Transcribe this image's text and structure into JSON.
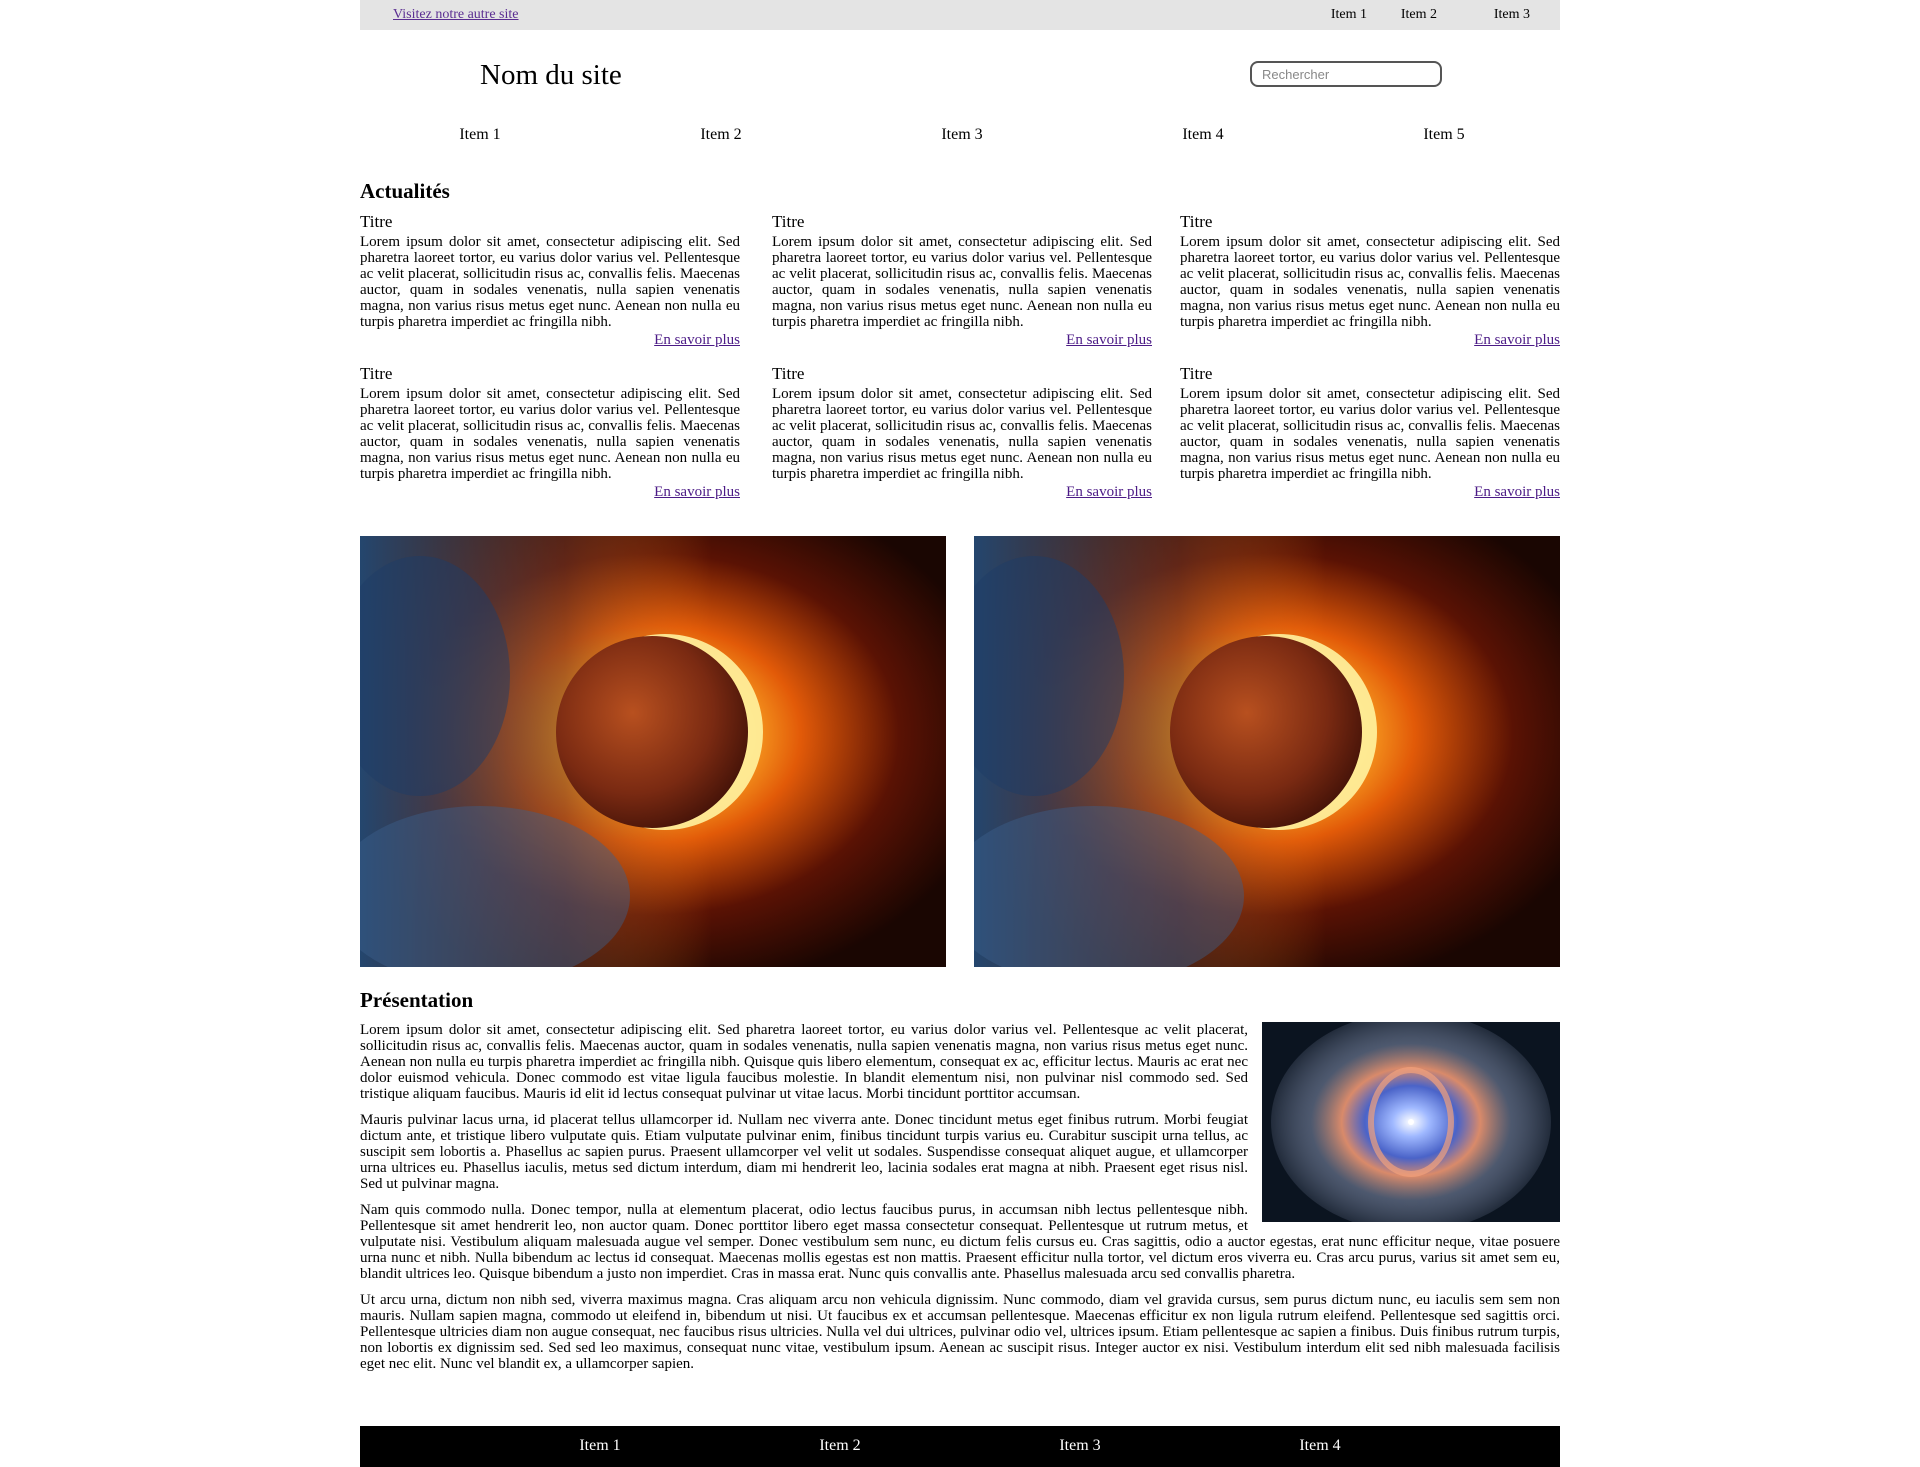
{
  "topbar": {
    "other_site_link": "Visitez notre autre site",
    "items": [
      "Item 1",
      "Item 2",
      "Item 3"
    ]
  },
  "header": {
    "site_name": "Nom du site",
    "search_placeholder": "Rechercher"
  },
  "main_nav": [
    "Item 1",
    "Item 2",
    "Item 3",
    "Item 4",
    "Item 5"
  ],
  "news": {
    "heading": "Actualités",
    "cards": [
      {
        "title": "Titre",
        "body": "Lorem ipsum dolor sit amet, consectetur adipiscing elit. Sed pharetra laoreet tortor, eu varius dolor varius vel. Pellentesque ac velit placerat, sollicitudin risus ac, convallis felis. Maecenas auctor, quam in sodales venenatis, nulla sapien venenatis magna, non varius risus metus eget nunc. Aenean non nulla eu turpis pharetra imperdiet ac fringilla nibh.",
        "more": "En savoir plus"
      },
      {
        "title": "Titre",
        "body": "Lorem ipsum dolor sit amet, consectetur adipiscing elit. Sed pharetra laoreet tortor, eu varius dolor varius vel. Pellentesque ac velit placerat, sollicitudin risus ac, convallis felis. Maecenas auctor, quam in sodales venenatis, nulla sapien venenatis magna, non varius risus metus eget nunc. Aenean non nulla eu turpis pharetra imperdiet ac fringilla nibh.",
        "more": "En savoir plus"
      },
      {
        "title": "Titre",
        "body": "Lorem ipsum dolor sit amet, consectetur adipiscing elit. Sed pharetra laoreet tortor, eu varius dolor varius vel. Pellentesque ac velit placerat, sollicitudin risus ac, convallis felis. Maecenas auctor, quam in sodales venenatis, nulla sapien venenatis magna, non varius risus metus eget nunc. Aenean non nulla eu turpis pharetra imperdiet ac fringilla nibh.",
        "more": "En savoir plus"
      },
      {
        "title": "Titre",
        "body": "Lorem ipsum dolor sit amet, consectetur adipiscing elit. Sed pharetra laoreet tortor, eu varius dolor varius vel. Pellentesque ac velit placerat, sollicitudin risus ac, convallis felis. Maecenas auctor, quam in sodales venenatis, nulla sapien venenatis magna, non varius risus metus eget nunc. Aenean non nulla eu turpis pharetra imperdiet ac fringilla nibh.",
        "more": "En savoir plus"
      },
      {
        "title": "Titre",
        "body": "Lorem ipsum dolor sit amet, consectetur adipiscing elit. Sed pharetra laoreet tortor, eu varius dolor varius vel. Pellentesque ac velit placerat, sollicitudin risus ac, convallis felis. Maecenas auctor, quam in sodales venenatis, nulla sapien venenatis magna, non varius risus metus eget nunc. Aenean non nulla eu turpis pharetra imperdiet ac fringilla nibh.",
        "more": "En savoir plus"
      },
      {
        "title": "Titre",
        "body": "Lorem ipsum dolor sit amet, consectetur adipiscing elit. Sed pharetra laoreet tortor, eu varius dolor varius vel. Pellentesque ac velit placerat, sollicitudin risus ac, convallis felis. Maecenas auctor, quam in sodales venenatis, nulla sapien venenatis magna, non varius risus metus eget nunc. Aenean non nulla eu turpis pharetra imperdiet ac fringilla nibh.",
        "more": "En savoir plus"
      }
    ]
  },
  "presentation": {
    "heading": "Présentation",
    "paragraphs": [
      "Lorem ipsum dolor sit amet, consectetur adipiscing elit. Sed pharetra laoreet tortor, eu varius dolor varius vel. Pellentesque ac velit placerat, sollicitudin risus ac, convallis felis. Maecenas auctor, quam in sodales venenatis, nulla sapien venenatis magna, non varius risus metus eget nunc. Aenean non nulla eu turpis pharetra imperdiet ac fringilla nibh. Quisque quis libero elementum, consequat ex ac, efficitur lectus. Mauris ac erat nec dolor euismod vehicula. Donec commodo est vitae ligula faucibus molestie. In blandit elementum nisi, non pulvinar nisl commodo sed. Sed tristique aliquam faucibus. Mauris id elit id lectus consequat pulvinar ut vitae lacus. Morbi tincidunt porttitor accumsan.",
      "Mauris pulvinar lacus urna, id placerat tellus ullamcorper id. Nullam nec viverra ante. Donec tincidunt metus eget finibus rutrum. Morbi feugiat dictum ante, et tristique libero vulputate quis. Etiam vulputate pulvinar enim, finibus tincidunt turpis varius eu. Curabitur suscipit urna tellus, ac suscipit sem lobortis a. Phasellus ac sapien purus. Praesent ullamcorper vel velit ut sodales. Suspendisse consequat aliquet augue, et ullamcorper urna ultrices eu. Phasellus iaculis, metus sed dictum interdum, diam mi hendrerit leo, lacinia sodales erat magna at nibh. Praesent eget risus nisl. Sed ut pulvinar magna.",
      "Nam quis commodo nulla. Donec tempor, nulla at elementum placerat, odio lectus faucibus purus, in accumsan nibh lectus pellentesque nibh. Pellentesque sit amet hendrerit leo, non auctor quam. Donec porttitor libero eget massa consectetur consequat. Pellentesque ut rutrum metus, et vulputate nisi. Vestibulum aliquam malesuada augue vel semper. Donec vestibulum sem nunc, eu dictum felis cursus eu. Cras sagittis, odio a auctor egestas, erat nunc efficitur neque, vitae posuere urna nunc et nibh. Nulla bibendum ac lectus id consequat. Maecenas mollis egestas est non mattis. Praesent efficitur nulla tortor, vel dictum eros viverra eu. Cras arcu purus, varius sit amet sem eu, blandit ultrices leo. Quisque bibendum a justo non imperdiet. Cras in massa erat. Nunc quis convallis ante. Phasellus malesuada arcu sed convallis pharetra.",
      "Ut arcu urna, dictum non nibh sed, viverra maximus magna. Cras aliquam arcu non vehicula dignissim. Nunc commodo, diam vel gravida cursus, sem purus dictum nunc, eu iaculis sem sem non mauris. Nullam sapien magna, commodo ut eleifend in, bibendum ut nisi. Ut faucibus ex et accumsan pellentesque. Maecenas efficitur ex non ligula rutrum eleifend. Pellentesque sed sagittis orci. Pellentesque ultricies diam non augue consequat, nec faucibus risus ultricies. Nulla vel dui ultrices, pulvinar odio vel, ultrices ipsum. Etiam pellentesque ac sapien a finibus. Duis finibus rutrum turpis, non lobortis ex dignissim sed. Sed sed leo maximus, consequat nunc vitae, vestibulum ipsum. Aenean ac suscipit risus. Integer auctor ex nisi. Vestibulum interdum elit sed nibh malesuada facilisis eget nec elit. Nunc vel blandit ex, a ullamcorper sapien."
    ]
  },
  "footer": {
    "items": [
      "Item 1",
      "Item 2",
      "Item 3",
      "Item 4"
    ]
  },
  "colors": {
    "topbar_bg": "#e4e4e4",
    "link": "#4b1a86",
    "footer_bg": "#000000"
  }
}
